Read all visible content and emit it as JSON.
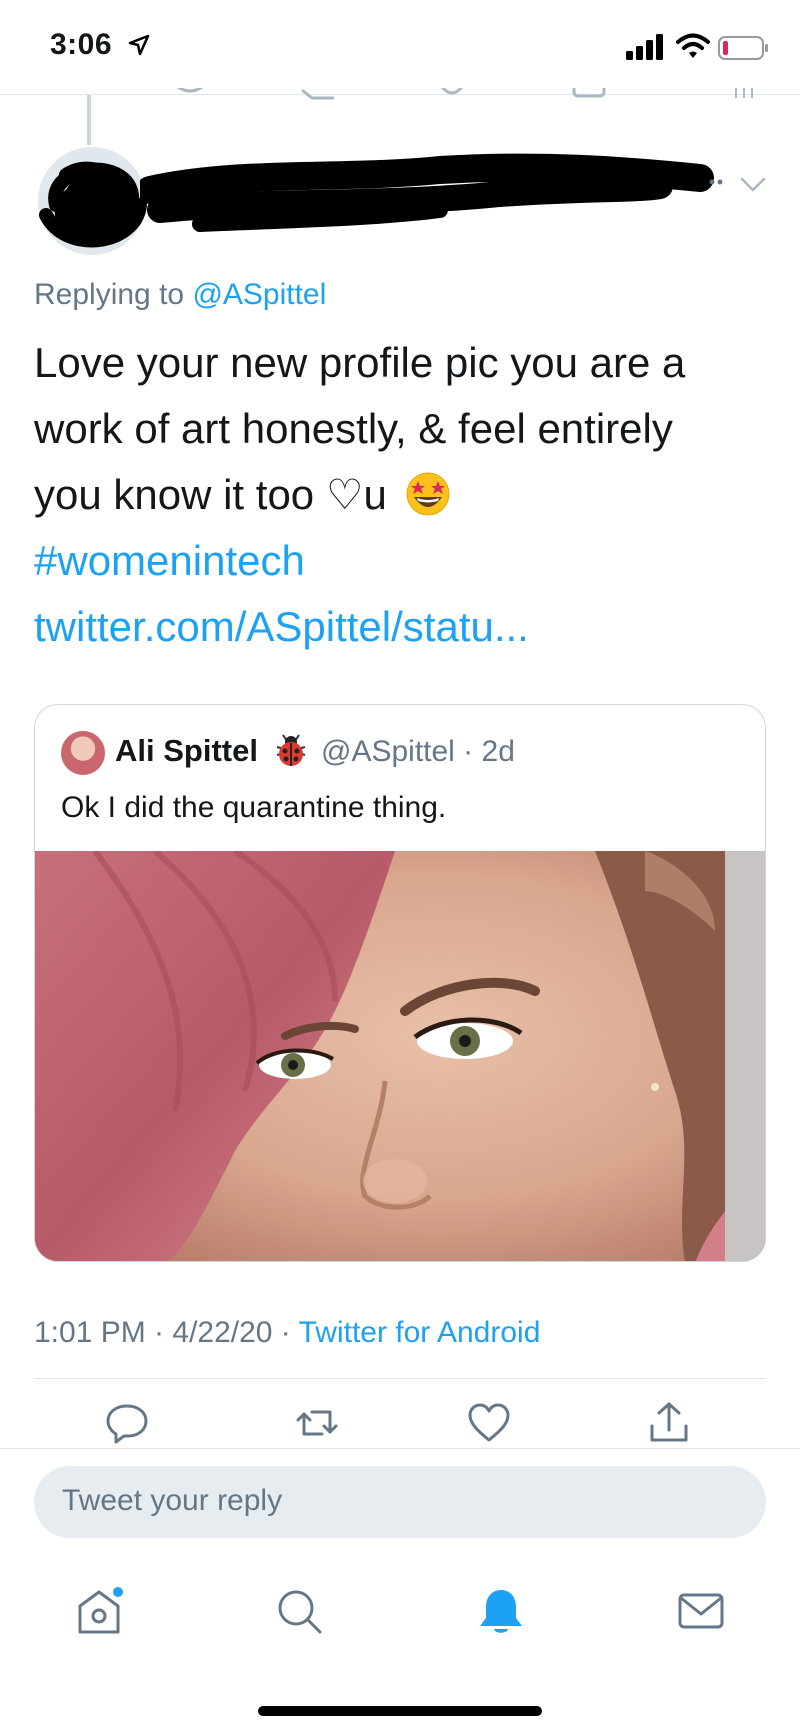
{
  "status_bar": {
    "time": "3:06"
  },
  "tweet": {
    "replying_prefix": "Replying to ",
    "replying_handle": "@ASpittel",
    "text_line1": "Love your new profile pic you are a",
    "text_line2": "work of art honestly, & feel entirely",
    "text_line3": "you know it too ♡u",
    "hashtag": "#womenintech",
    "link": "twitter.com/ASpittel/statu...",
    "timestamp": "1:01 PM · 4/22/20 · ",
    "client": "Twitter for Android"
  },
  "quoted_tweet": {
    "name": "Ali Spittel",
    "meta": "@ASpittel · 2d",
    "text": "Ok I did the quarantine thing."
  },
  "reply": {
    "placeholder": "Tweet your reply"
  },
  "icons": {
    "tweet_actions": [
      "reply-icon",
      "retweet-icon",
      "like-icon",
      "share-icon"
    ],
    "tabs": [
      "home-icon",
      "search-icon",
      "notifications-icon",
      "messages-icon"
    ]
  },
  "colors": {
    "accent": "#1da1f2",
    "secondary_text": "#657786",
    "reply_box": "#e6ecf0"
  }
}
